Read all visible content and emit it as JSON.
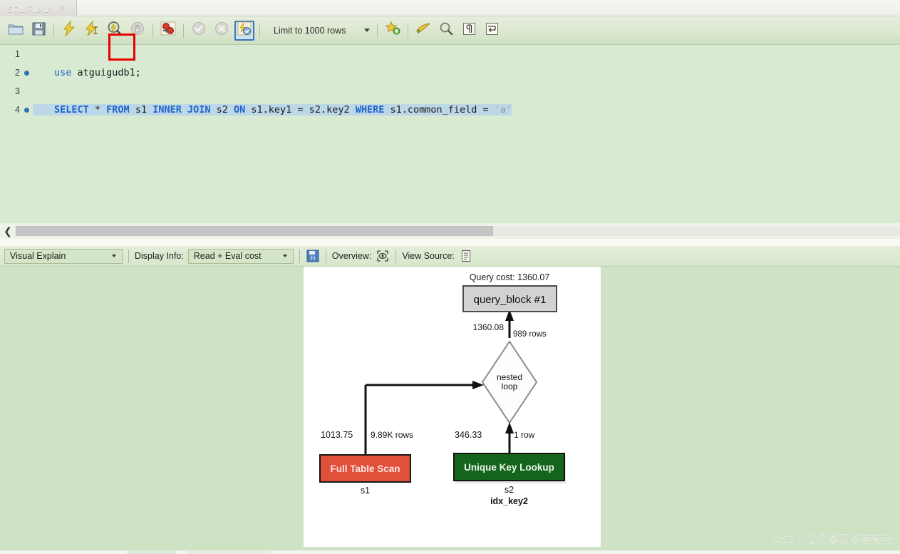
{
  "window": {
    "tab": {
      "label": "SQL File 1*",
      "close_icon": "close-icon"
    }
  },
  "toolbar": {
    "buttons": [
      {
        "name": "open-sql-script",
        "icon": "folder-icon",
        "label": "Open SQL Script"
      },
      {
        "name": "save-sql-script",
        "icon": "floppy-disk-icon",
        "label": "Save SQL Script"
      },
      {
        "name": "execute-statements",
        "icon": "lightning-icon",
        "label": "Execute"
      },
      {
        "name": "execute-current-statement",
        "icon": "lightning-cursor-icon",
        "label": "Execute Current Statement"
      },
      {
        "name": "explain-statement",
        "icon": "magnifier-lightning-icon",
        "label": "Explain Current Statement"
      },
      {
        "name": "stop-statement",
        "icon": "stop-hand-icon",
        "label": "Stop"
      },
      {
        "name": "toggle-stop-on-error",
        "icon": "stop-on-error-icon",
        "label": "Toggle Stop On Error"
      },
      {
        "name": "commit-transaction",
        "icon": "check-circle-icon",
        "label": "Commit"
      },
      {
        "name": "rollback-transaction",
        "icon": "x-circle-icon",
        "label": "Rollback"
      },
      {
        "name": "toggle-autocommit",
        "icon": "autocommit-icon",
        "label": "Toggle Autocommit"
      }
    ],
    "limit_combo": {
      "label": "Limit to 1000 rows",
      "caret": "chevron-down-icon"
    },
    "right_buttons": [
      {
        "name": "toggle-snippets",
        "icon": "star-plus-icon",
        "label": "Snippets"
      },
      {
        "name": "beautify-query",
        "icon": "brush-icon",
        "label": "Beautify Query"
      },
      {
        "name": "find-panel",
        "icon": "search-icon",
        "label": "Find"
      },
      {
        "name": "toggle-invisible-chars",
        "icon": "pilcrow-icon",
        "label": "Show Invisible Characters"
      },
      {
        "name": "toggle-word-wrap",
        "icon": "wrap-icon",
        "label": "Toggle Word Wrap"
      }
    ]
  },
  "editor": {
    "lines": [
      {
        "number": "1",
        "breakpoint": false,
        "tokens": []
      },
      {
        "number": "2",
        "breakpoint": true,
        "tokens": [
          {
            "t": "use",
            "c": "kw2"
          },
          {
            "t": " atguigudb1;",
            "c": "plain"
          }
        ]
      },
      {
        "number": "3",
        "breakpoint": false,
        "tokens": []
      },
      {
        "number": "4",
        "breakpoint": true,
        "selected": true,
        "tokens": [
          {
            "t": "SELECT",
            "c": "kw"
          },
          {
            "t": " * ",
            "c": "plain"
          },
          {
            "t": "FROM",
            "c": "kw"
          },
          {
            "t": " s1 ",
            "c": "plain"
          },
          {
            "t": "INNER",
            "c": "kw"
          },
          {
            "t": " ",
            "c": "plain"
          },
          {
            "t": "JOIN",
            "c": "kw"
          },
          {
            "t": " s2 ",
            "c": "plain"
          },
          {
            "t": "ON",
            "c": "kw"
          },
          {
            "t": " s1.key1 = s2.key2 ",
            "c": "plain"
          },
          {
            "t": "WHERE",
            "c": "kw"
          },
          {
            "t": " s1.common_field = ",
            "c": "plain"
          },
          {
            "t": "'a'",
            "c": "str"
          }
        ]
      }
    ]
  },
  "explain_bar": {
    "view_select": {
      "value": "Visual Explain",
      "caret": "chevron-down-icon"
    },
    "display_info_label": "Display Info:",
    "display_info_select": {
      "value": "Read + Eval cost",
      "caret": "chevron-down-icon"
    },
    "save_icon": "save-diagram-icon",
    "overview_label": "Overview:",
    "overview_icon": "overview-eye-icon",
    "view_source_label": "View Source:",
    "view_source_icon": "document-lines-icon"
  },
  "explain_diagram": {
    "query_cost_label": "Query cost: 1360.07",
    "query_block": "query_block #1",
    "join_node": {
      "line1": "nested",
      "line2": "loop"
    },
    "join_cost": "1360.08",
    "join_rows": "989 rows",
    "nodes": [
      {
        "name": "full-table-scan-node",
        "title": "Full Table Scan",
        "cost": "1013.75",
        "rows": "9.89K rows",
        "table": "s1",
        "index": "",
        "color": "#e0503a",
        "text_color": "#ffe6e0"
      },
      {
        "name": "unique-key-lookup-node",
        "title": "Unique Key Lookup",
        "cost": "346.33",
        "rows": "1 row",
        "table": "s2",
        "index": "idx_key2",
        "color": "#14641b",
        "text_color": "#e8f6e8"
      }
    ]
  },
  "watermark": {
    "text": "CSDN @风筝风筝等等我"
  }
}
